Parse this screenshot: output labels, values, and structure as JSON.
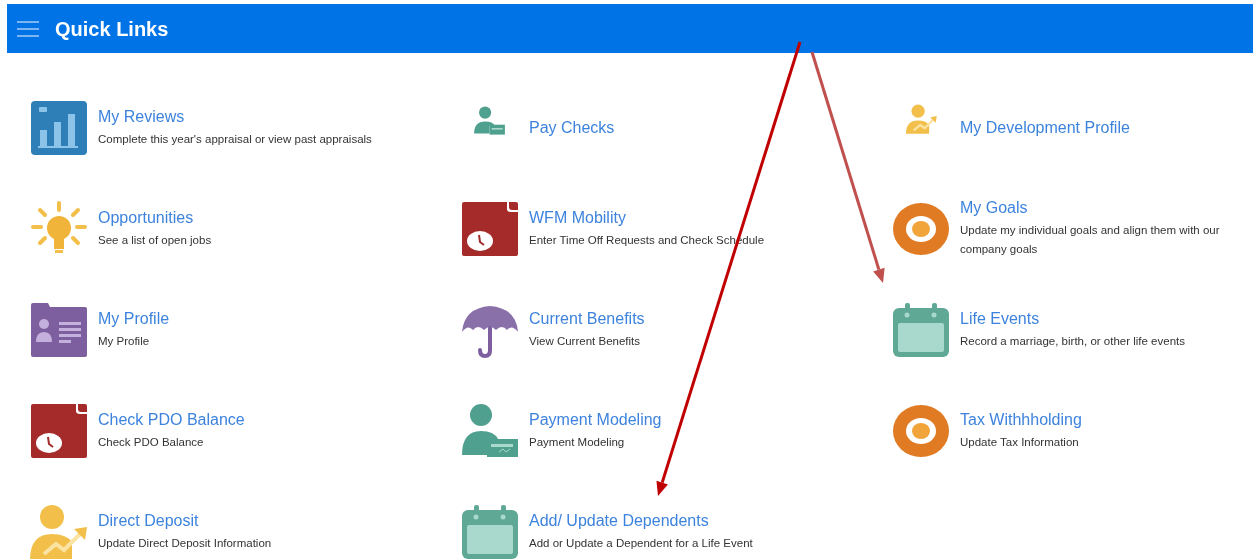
{
  "header": {
    "title": "Quick Links"
  },
  "items": [
    {
      "title": "My Reviews",
      "description": "Complete this year's appraisal or view past appraisals",
      "kind": "chart"
    },
    {
      "title": "Pay Checks",
      "kind": "person-check-small"
    },
    {
      "title": "My Development Profile",
      "kind": "person-growth-small"
    },
    {
      "title": "Opportunities",
      "description": "See a list of open jobs",
      "kind": "bulb"
    },
    {
      "title": "WFM Mobility",
      "description": "Enter Time Off Requests and Check Schedule",
      "kind": "clock-note"
    },
    {
      "title": "My Goals",
      "description": "Update my individual goals and align them with our company goals",
      "kind": "target"
    },
    {
      "title": "My Profile",
      "description": "My Profile",
      "kind": "id-card"
    },
    {
      "title": "Current Benefits",
      "description": "View Current Benefits",
      "kind": "umbrella"
    },
    {
      "title": "Life Events",
      "description": "Record a marriage, birth, or other life events",
      "kind": "calendar"
    },
    {
      "title": "Check PDO Balance",
      "description": "Check PDO Balance",
      "kind": "clock-note"
    },
    {
      "title": "Payment Modeling",
      "description": "Payment Modeling",
      "kind": "person-check"
    },
    {
      "title": "Tax Withhholding",
      "description": "Update Tax Information",
      "kind": "target"
    },
    {
      "title": "Direct Deposit",
      "description": "Update Direct Deposit Information",
      "kind": "person-growth"
    },
    {
      "title": "Add/ Update Dependents",
      "description": "Add or Update a Dependent for a Life Event",
      "kind": "calendar"
    }
  ],
  "annotations": [
    {
      "kind": "arrow",
      "color": "#c00000"
    },
    {
      "kind": "arrow",
      "color": "#c0504d"
    }
  ]
}
